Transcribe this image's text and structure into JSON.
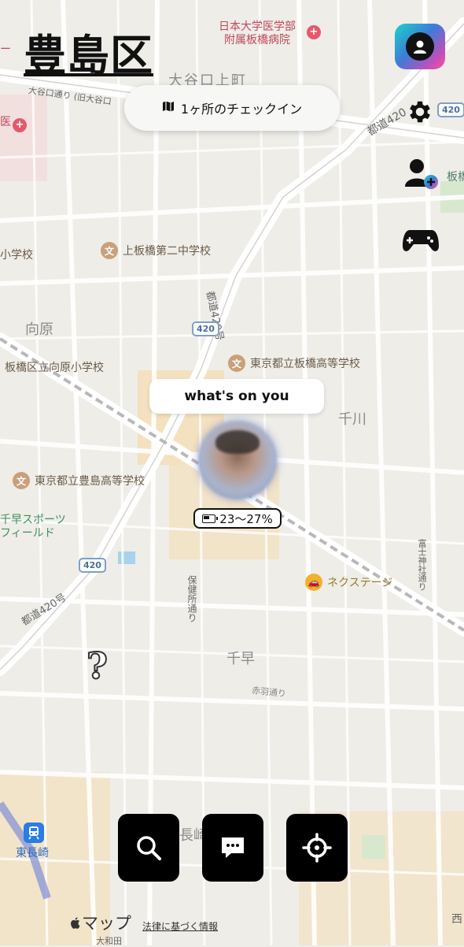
{
  "header": {
    "ward_title": "豊島区",
    "checkin_label": "1ヶ所のチェックイン"
  },
  "status": {
    "bubble_text": "what's on you",
    "battery_text": "23〜27%",
    "mystery_glyph": "?"
  },
  "side_icons": [
    "account-icon",
    "gear-icon",
    "add-friend-icon",
    "gamepad-icon"
  ],
  "bottom_bar": [
    "search-icon",
    "chat-icon",
    "locate-icon"
  ],
  "map": {
    "hospital": [
      "日本大学医学部",
      "附属板橋病院"
    ],
    "top_partial": "ー",
    "area_oyaguchi_kamimachi": "大谷口上町",
    "road_oyaguchi": "大谷口通り (旧大谷口",
    "area_ik": "医",
    "road_pref_top": "都道420",
    "school_kamiitabashi": "上板橋第二中学校",
    "school_partial": "小学校",
    "road_pref_vertical": "都道420号",
    "area_mukaihara": "向原",
    "school_mukaihara": "板橋区立向原小学校",
    "school_itabashi_high": "東京都立板橋高等学校",
    "area_senkawa": "千川",
    "school_toshima_high": "東京都立豊島高等学校",
    "sports_field": [
      "千早スポーツ",
      "フィールド"
    ],
    "place_nextage": "ネクステージ",
    "road_fujimi": "富士神社通り",
    "road_pref_lower": "都道420号",
    "road_hoken": "保健所通り",
    "area_chihaya": "千早",
    "road_akabane": "赤羽通り",
    "area_nagasaki": "長崎",
    "station_higashinagasaki": "東長崎",
    "road_yamato": "大和田",
    "area_itabashi_partial": "板橋",
    "area_nishi": "西",
    "shield_number": "420",
    "footer_maps": "マップ",
    "footer_legal": "法律に基づく情報"
  },
  "colors": {
    "map_bg": "#eeede8",
    "road": "#ffffff",
    "green": "#d8e8cf",
    "orange_zone": "#f6dcae",
    "poi": "#c9a07a",
    "accent_blue": "#3d7bd8"
  }
}
